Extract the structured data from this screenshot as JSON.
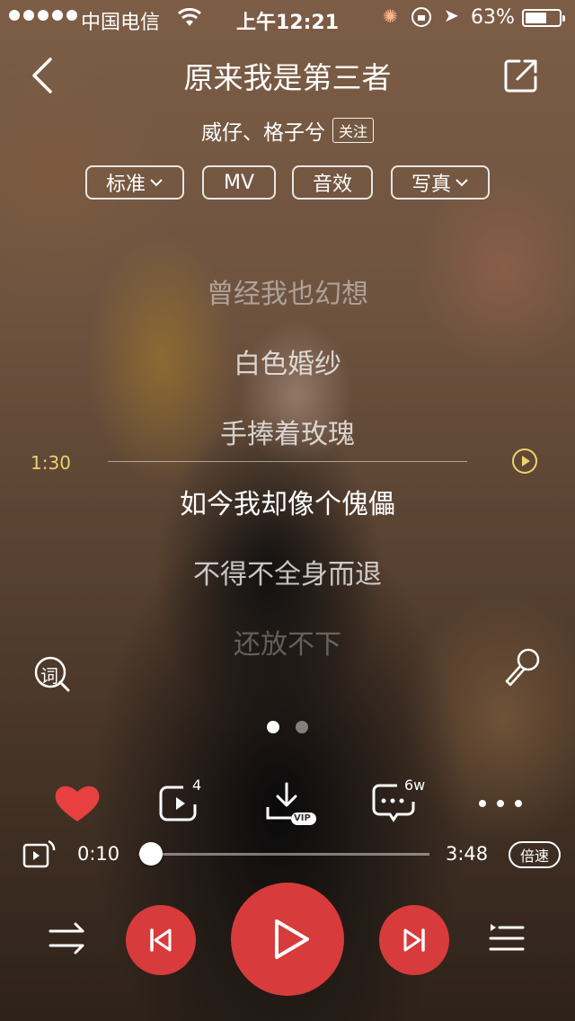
{
  "status_bar": {
    "carrier": "中国电信",
    "time": "上午12:21",
    "battery_percent_text": "63%",
    "battery_level": 0.63
  },
  "header": {
    "song_title": "原来我是第三者",
    "artist": "威仔、格子兮",
    "follow_label": "关注"
  },
  "options": {
    "quality": "标准",
    "mv": "MV",
    "effects": "音效",
    "photo": "写真"
  },
  "lyrics": {
    "lines": [
      "曾经我也幻想",
      "白色婚纱",
      "手捧着玫瑰",
      "如今我却像个傀儡",
      "不得不全身而退",
      "还放不下"
    ],
    "scroll_time": "1:30"
  },
  "lyric_tool": {
    "word_icon_label": "词"
  },
  "pager": {
    "count": 2,
    "active": 0
  },
  "actions": {
    "liked": true,
    "remix_count": "4",
    "download_badge": "VIP",
    "comment_count": "6w"
  },
  "playback": {
    "current_time": "0:10",
    "total_time": "3:48",
    "progress": 0.044,
    "buffered": 0.07,
    "speed_label": "倍速",
    "playing": false
  },
  "colors": {
    "accent": "#d83b3b",
    "lyric_time": "#e8d46a"
  }
}
